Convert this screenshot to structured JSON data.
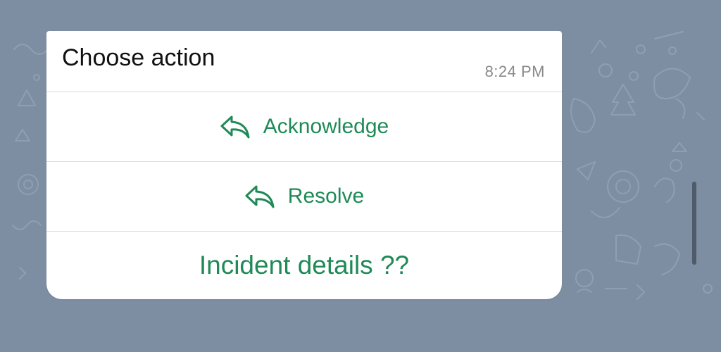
{
  "message": {
    "title": "Choose action",
    "time": "8:24 PM"
  },
  "actions": [
    {
      "label": "Acknowledge",
      "icon": "reply-arrow-icon"
    },
    {
      "label": "Resolve",
      "icon": "reply-arrow-icon"
    },
    {
      "label": "Incident details ??"
    }
  ],
  "colors": {
    "background": "#7d8ea3",
    "card": "#ffffff",
    "accent": "#1f8a57",
    "time": "#8a8a8a",
    "divider": "#dcdcdc",
    "scrollbar": "#4f5b6a"
  }
}
